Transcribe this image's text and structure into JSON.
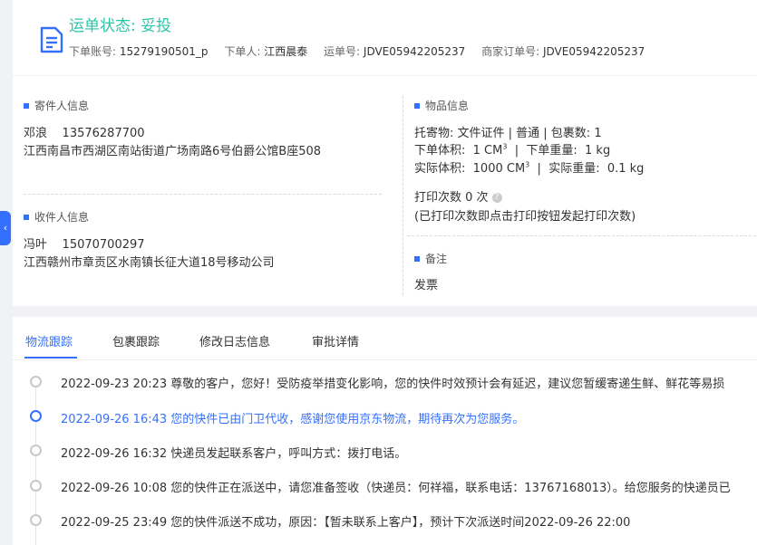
{
  "header": {
    "status_title": "运单状态: 妥投",
    "account_label": "下单账号:",
    "account_value": "15279190501_p",
    "orderer_label": "下单人:",
    "orderer_value": "江西晨泰",
    "waybill_label": "运单号:",
    "waybill_value": "JDVE05942205237",
    "merchant_label": "商家订单号:",
    "merchant_value": "JDVE05942205237"
  },
  "sender": {
    "title": "寄件人信息",
    "name": "邓浪",
    "phone": "13576287700",
    "address": "江西南昌市西湖区南站街道广场南路6号伯爵公馆B座508"
  },
  "receiver": {
    "title": "收件人信息",
    "name": "冯叶",
    "phone": "15070700297",
    "address": "江西赣州市章贡区水南镇长征大道18号移动公司"
  },
  "goods": {
    "title": "物品信息",
    "line1": "托寄物:  文件证件 | 普通  |  包裹数:  1",
    "volume_label": "下单体积:",
    "volume_value": "1 CM",
    "weight_label": "下单重量:",
    "weight_value": "1 kg",
    "actual_volume_label": "实际体积:",
    "actual_volume_value": "1000 CM",
    "actual_weight_label": "实际重量:",
    "actual_weight_value": "0.1 kg",
    "cube": "3",
    "print_count": "打印次数   0 次",
    "print_hint": "(已打印次数即点击打印按钮发起打印次数)",
    "qmark": "?"
  },
  "remark": {
    "title": "备注",
    "value": "发票"
  },
  "tabs": [
    "物流跟踪",
    "包裹跟踪",
    "修改日志信息",
    "审批详情"
  ],
  "collapse_glyph": "‹",
  "timeline": [
    {
      "time": "2022-09-23 20:23",
      "text": "尊敬的客户，您好！受防疫举措变化影响，您的快件时效预计会有延迟，建议您暂缓寄递生鲜、鲜花等易损"
    },
    {
      "time": "2022-09-26 16:43",
      "text": "您的快件已由门卫代收，感谢您使用京东物流，期待再次为您服务。"
    },
    {
      "time": "2022-09-26 16:32",
      "text": "快递员发起联系客户，呼叫方式：拨打电话。"
    },
    {
      "time": "2022-09-26 10:08",
      "text": "您的快件正在派送中，请您准备签收（快递员：何祥福，联系电话：13767168013）。给您服务的快递员已"
    },
    {
      "time": "2022-09-25 23:49",
      "text": "您的快件派送不成功，原因：【暂未联系上客户】，预计下次派送时间2022-09-26 22:00"
    }
  ]
}
